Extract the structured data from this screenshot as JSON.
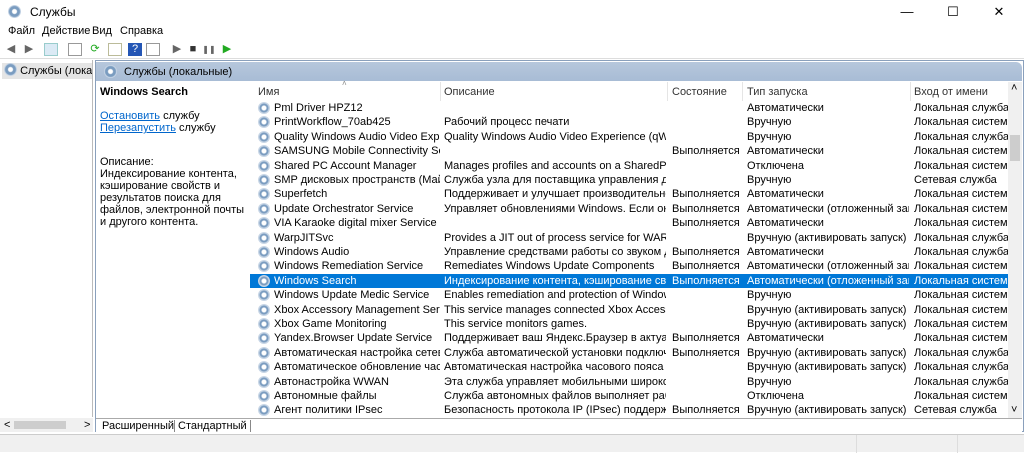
{
  "window": {
    "title": "Службы",
    "min": "—",
    "max": "☐",
    "close": "✕"
  },
  "menu": [
    "Файл",
    "Действие",
    "Вид",
    "Справка"
  ],
  "toolbar": {
    "back": "◀",
    "forward": "▶",
    "play": "▶",
    "stop": "■",
    "pause": "❚❚",
    "restart": "▶"
  },
  "tree": {
    "item": "Службы (локальные)"
  },
  "band": {
    "title": "Службы (локальные)"
  },
  "details": {
    "service": "Windows Search",
    "stop_link": "Остановить",
    "stop_rest": " службу",
    "restart_link": "Перезапустить",
    "restart_rest": " службу",
    "desc_label": "Описание:",
    "desc": "Индексирование контента, кэширование свойств и результатов поиска для файлов, электронной почты и другого контента."
  },
  "columns": [
    "Имя",
    "Описание",
    "Состояние",
    "Тип запуска",
    "Вход от имени"
  ],
  "rows": [
    [
      "Pml Driver HPZ12",
      "",
      "",
      "Автоматически",
      "Локальная служба"
    ],
    [
      "PrintWorkflow_70ab425",
      "Рабочий процесс печати",
      "",
      "Вручную",
      "Локальная система"
    ],
    [
      "Quality Windows Audio Video Experience",
      "Quality Windows Audio Video Experience (qWave) - с...",
      "",
      "Вручную",
      "Локальная служба"
    ],
    [
      "SAMSUNG Mobile Connectivity Service",
      "",
      "Выполняется",
      "Автоматически",
      "Локальная система"
    ],
    [
      "Shared PC Account Manager",
      "Manages profiles and accounts on a SharedPC config...",
      "",
      "Отключена",
      "Локальная система"
    ],
    [
      "SMP дисковых пространств (Майкрос...",
      "Служба узла для поставщика управления дисковы...",
      "",
      "Вручную",
      "Сетевая служба"
    ],
    [
      "Superfetch",
      "Поддерживает и улучшает производительность си...",
      "Выполняется",
      "Автоматически",
      "Локальная система"
    ],
    [
      "Update Orchestrator Service",
      "Управляет обновлениями Windows. Если она оста...",
      "Выполняется",
      "Автоматически (отложенный запуск)",
      "Локальная система"
    ],
    [
      "VIA Karaoke digital mixer Service",
      "",
      "Выполняется",
      "Автоматически",
      "Локальная система"
    ],
    [
      "WarpJITSvc",
      "Provides a JIT out of process service for WARP when r...",
      "",
      "Вручную (активировать запуск)",
      "Локальная служба"
    ],
    [
      "Windows Audio",
      "Управление средствами работы со звуком для про...",
      "Выполняется",
      "Автоматически",
      "Локальная служба"
    ],
    [
      "Windows Remediation Service",
      "Remediates Windows Update Components",
      "Выполняется",
      "Автоматически (отложенный запуск)",
      "Локальная система"
    ],
    [
      "Windows Search",
      "Индексирование контента, кэширование свойств ...",
      "Выполняется",
      "Автоматически (отложенный запуск)",
      "Локальная система"
    ],
    [
      "Windows Update Medic Service",
      "Enables remediation and protection of Windows Upd...",
      "",
      "Вручную",
      "Локальная система"
    ],
    [
      "Xbox Accessory Management Service",
      "This service manages connected Xbox Accessories.",
      "",
      "Вручную (активировать запуск)",
      "Локальная система"
    ],
    [
      "Xbox Game Monitoring",
      "This service monitors games.",
      "",
      "Вручную (активировать запуск)",
      "Локальная система"
    ],
    [
      "Yandex.Browser Update Service",
      "Поддерживает ваш Яндекс.Браузер в актуальном с...",
      "Выполняется",
      "Автоматически",
      "Локальная система"
    ],
    [
      "Автоматическая настройка сетевых у...",
      "Служба автоматической установки подключенны...",
      "Выполняется",
      "Вручную (активировать запуск)",
      "Локальная служба"
    ],
    [
      "Автоматическое обновление часовог...",
      "Автоматическая настройка часового пояса для си...",
      "",
      "Вручную (активировать запуск)",
      "Локальная служба"
    ],
    [
      "Автонастройка WWAN",
      "Эта служба управляет мобильными широкополос...",
      "",
      "Вручную",
      "Локальная служба"
    ],
    [
      "Автономные файлы",
      "Служба автономных файлов выполняет работу по...",
      "",
      "Отключена",
      "Локальная система"
    ],
    [
      "Агент политики IPsec",
      "Безопасность протокола IP (IPsec) поддерживает п...",
      "Выполняется",
      "Вручную (активировать запуск)",
      "Сетевая служба"
    ]
  ],
  "selected_row": 12,
  "tabs": [
    "Расширенный",
    "Стандартный"
  ],
  "scroll": {
    "up": "˄",
    "down": "˅",
    "left": "<",
    "right": ">"
  },
  "colors": {
    "selection": "#0078d7",
    "band": "#b6c7dc",
    "link": "#0066cc"
  }
}
